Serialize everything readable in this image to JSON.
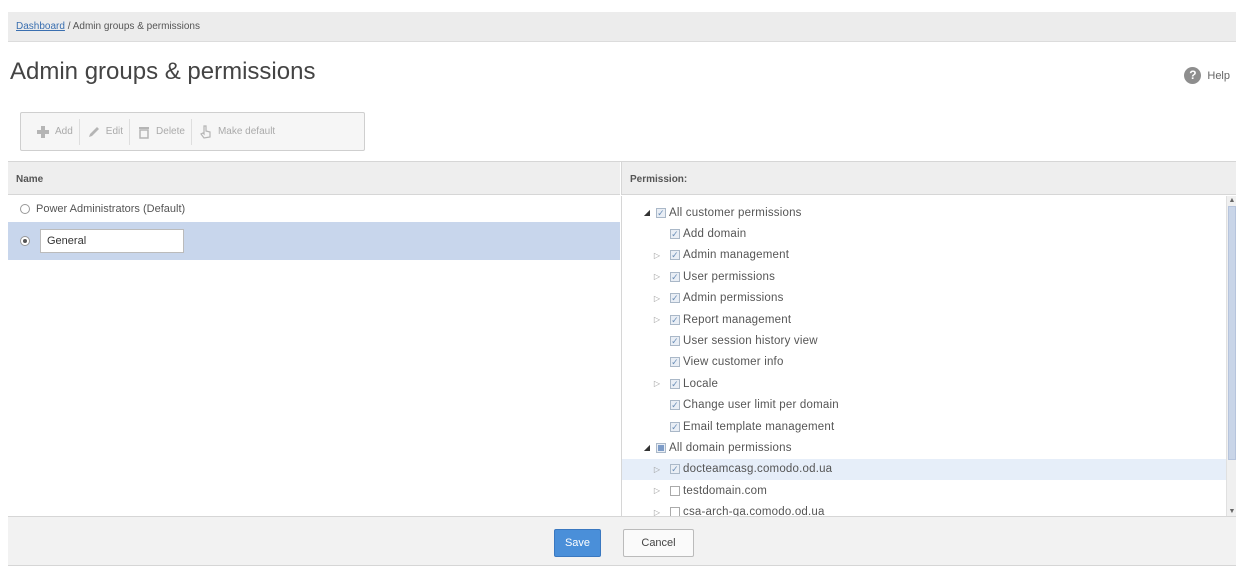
{
  "breadcrumb": {
    "link": "Dashboard",
    "separator": "/",
    "current": "Admin groups & permissions"
  },
  "page_title": "Admin groups & permissions",
  "help_label": "Help",
  "toolbar": {
    "add_label": "Add",
    "edit_label": "Edit",
    "delete_label": "Delete",
    "make_default_label": "Make default"
  },
  "columns": {
    "name": "Name",
    "permission": "Permission:"
  },
  "groups": [
    {
      "label": "Power Administrators (Default)",
      "selected": false
    },
    {
      "value": "General",
      "selected": true
    }
  ],
  "permissions": [
    {
      "label": "All customer permissions",
      "state": "checked",
      "arrow": "expanded"
    },
    {
      "label": "Add domain",
      "state": "checked",
      "arrow": "none"
    },
    {
      "label": "Admin management",
      "state": "checked",
      "arrow": "collapsed"
    },
    {
      "label": "User permissions",
      "state": "checked",
      "arrow": "collapsed"
    },
    {
      "label": "Admin permissions",
      "state": "checked",
      "arrow": "collapsed"
    },
    {
      "label": "Report management",
      "state": "checked",
      "arrow": "collapsed"
    },
    {
      "label": "User session history view",
      "state": "checked",
      "arrow": "none"
    },
    {
      "label": "View customer info",
      "state": "checked",
      "arrow": "none"
    },
    {
      "label": "Locale",
      "state": "checked",
      "arrow": "collapsed"
    },
    {
      "label": "Change user limit per domain",
      "state": "checked",
      "arrow": "none"
    },
    {
      "label": "Email template management",
      "state": "checked",
      "arrow": "none"
    },
    {
      "label": "All domain permissions",
      "state": "partial",
      "arrow": "expanded"
    },
    {
      "label": "docteamcasg.comodo.od.ua",
      "state": "checked",
      "arrow": "collapsed"
    },
    {
      "label": "testdomain.com",
      "state": "unchecked",
      "arrow": "collapsed"
    },
    {
      "label": "csa-arch-qa.comodo.od.ua",
      "state": "unchecked",
      "arrow": "collapsed"
    }
  ],
  "footer": {
    "save_label": "Save",
    "cancel_label": "Cancel"
  },
  "colors": {
    "primary_button": "#4a8fd9",
    "selection": "#c8d6ec",
    "checkbox_check": "#6b8fb8"
  }
}
